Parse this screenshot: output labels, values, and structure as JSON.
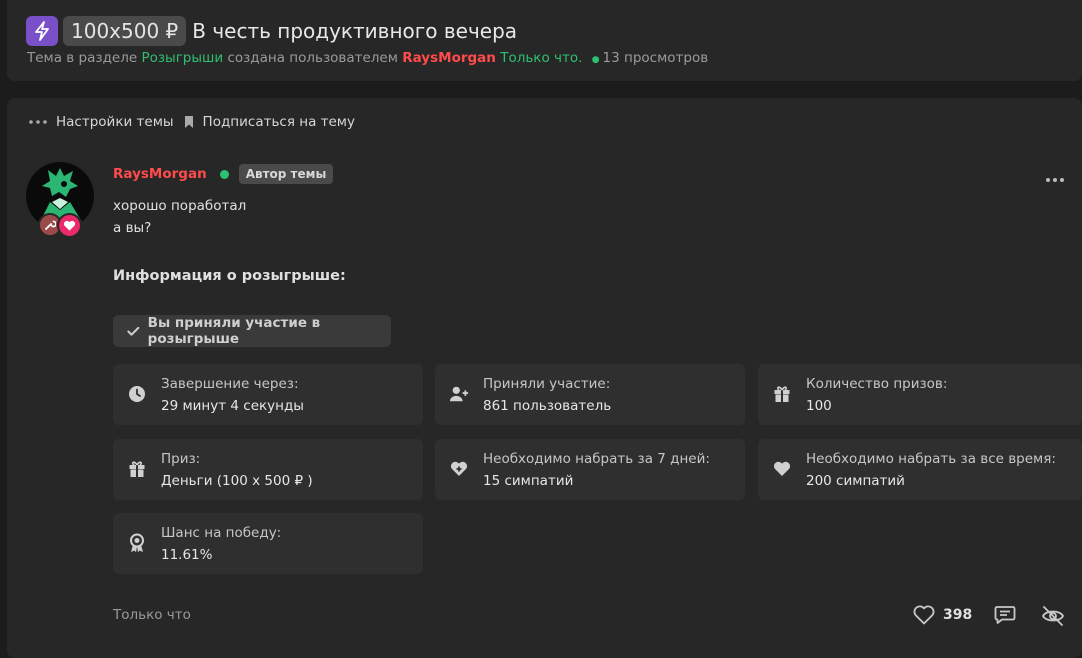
{
  "thread": {
    "prefix": "100x500 ₽",
    "title": "В честь продуктивного вечера",
    "meta": {
      "part1": "Тема в разделе",
      "section": "Розыгрыши",
      "part2": "создана пользователем",
      "author": "RaysMorgan",
      "time": "Только что.",
      "views": "13 просмотров"
    }
  },
  "toolbar": {
    "settings": "Настройки темы",
    "subscribe": "Подписаться на тему"
  },
  "post": {
    "author": "RaysMorgan",
    "author_tag": "Автор темы",
    "line1": "хорошо поработал",
    "line2": "а вы?",
    "info_title": "Информация о розыгрыше:",
    "participated": "Вы приняли участие в розыгрыше",
    "cards": [
      {
        "label": "Завершение через:",
        "value": "29 минут 4 секунды"
      },
      {
        "label": "Приняли участие:",
        "value": "861 пользователь"
      },
      {
        "label": "Количество призов:",
        "value": "100"
      },
      {
        "label": "Приз:",
        "value": "Деньги (100 x 500 ₽ )"
      },
      {
        "label": "Необходимо набрать за 7 дней:",
        "value": "15 симпатий"
      },
      {
        "label": "Необходимо набрать за все время:",
        "value": "200 симпатий"
      },
      {
        "label": "Шанс на победу:",
        "value": "11.61%"
      }
    ],
    "time": "Только что",
    "likes": "398"
  },
  "colors": {
    "accent_green": "#2fbf71",
    "author_red": "#ff4b4b",
    "prefix_purple": "#7a50c8"
  }
}
